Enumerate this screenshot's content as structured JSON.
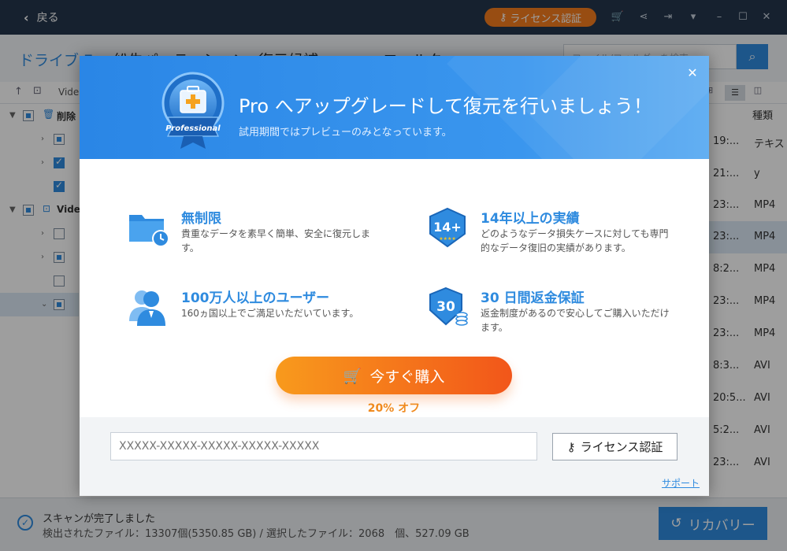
{
  "titlebar": {
    "back_label": "戻る",
    "license_label": "ライセンス認証",
    "icons": [
      "cart-icon",
      "share-icon",
      "signin-icon",
      "menu-icon",
      "minimize-icon",
      "maximize-icon",
      "close-icon"
    ]
  },
  "nav": {
    "tabs": [
      "ドライブ E",
      "紛失パーティション",
      "復元候補",
      "フィルタ"
    ],
    "search_placeholder": "ファイル/フォルダーを検索"
  },
  "path": {
    "text": "Vide"
  },
  "tree": {
    "items": [
      {
        "label": "削除",
        "state": "part",
        "expanded": true
      },
      {
        "label": "",
        "state": "part"
      },
      {
        "label": "",
        "state": "on"
      },
      {
        "label": "",
        "state": "on"
      },
      {
        "label": "Vide",
        "state": "part",
        "expanded": true
      },
      {
        "label": "",
        "state": "off"
      },
      {
        "label": "",
        "state": "part"
      },
      {
        "label": "",
        "state": "off"
      },
      {
        "label": "",
        "state": "part"
      }
    ]
  },
  "filelist": {
    "type_header": "種類",
    "rows": [
      {
        "time": "19:...",
        "type": "テキス"
      },
      {
        "time": "21:...",
        "type": "y"
      },
      {
        "time": "23:...",
        "type": "MP4"
      },
      {
        "time": "23:...",
        "type": "MP4"
      },
      {
        "time": "8:2...",
        "type": "MP4"
      },
      {
        "time": "23:...",
        "type": "MP4"
      },
      {
        "time": "23:...",
        "type": "MP4"
      },
      {
        "time": "8:3...",
        "type": "AVI"
      },
      {
        "time": "20:5...",
        "type": "AVI"
      },
      {
        "time": "5:2...",
        "type": "AVI"
      },
      {
        "time": "23:...",
        "type": "AVI"
      }
    ]
  },
  "status": {
    "main": "スキャンが完了しました",
    "sub": "検出されたファイル：13307個(5350.85 GB) / 選択したファイル：2068　個、527.09 GB",
    "recover_label": "リカバリー"
  },
  "modal": {
    "title": "Pro へアップグレードして復元を行いましょう！",
    "subtitle": "試用期間ではプレビューのみとなっています。",
    "badge_text": "Professional",
    "features": [
      {
        "title": "無制限",
        "desc": "貴重なデータを素早く簡単、安全に復元します。",
        "icon": "folder-restore-icon"
      },
      {
        "title": "14年以上の実績",
        "desc": "どのようなデータ損失ケースに対しても専門的なデータ復旧の実績があります。",
        "icon": "shield-14-icon",
        "icon_text": "14+"
      },
      {
        "title": "100万人以上のユーザー",
        "desc": "160ヵ国以上でご満足いただいています。",
        "icon": "users-icon"
      },
      {
        "title": "30 日間返金保証",
        "desc": "返金制度があるので安心してご購入いただけます。",
        "icon": "shield-30-icon",
        "icon_text": "30"
      }
    ],
    "buy_label": "今すぐ購入",
    "discount": "20% オフ",
    "key_placeholder": "XXXXX-XXXXX-XXXXX-XXXXX-XXXXX",
    "license_label": "ライセンス認証",
    "support_label": "サポート"
  },
  "colors": {
    "accent": "#2f8bdf",
    "orange": "#f57c1e",
    "titlebar": "#24364c"
  }
}
